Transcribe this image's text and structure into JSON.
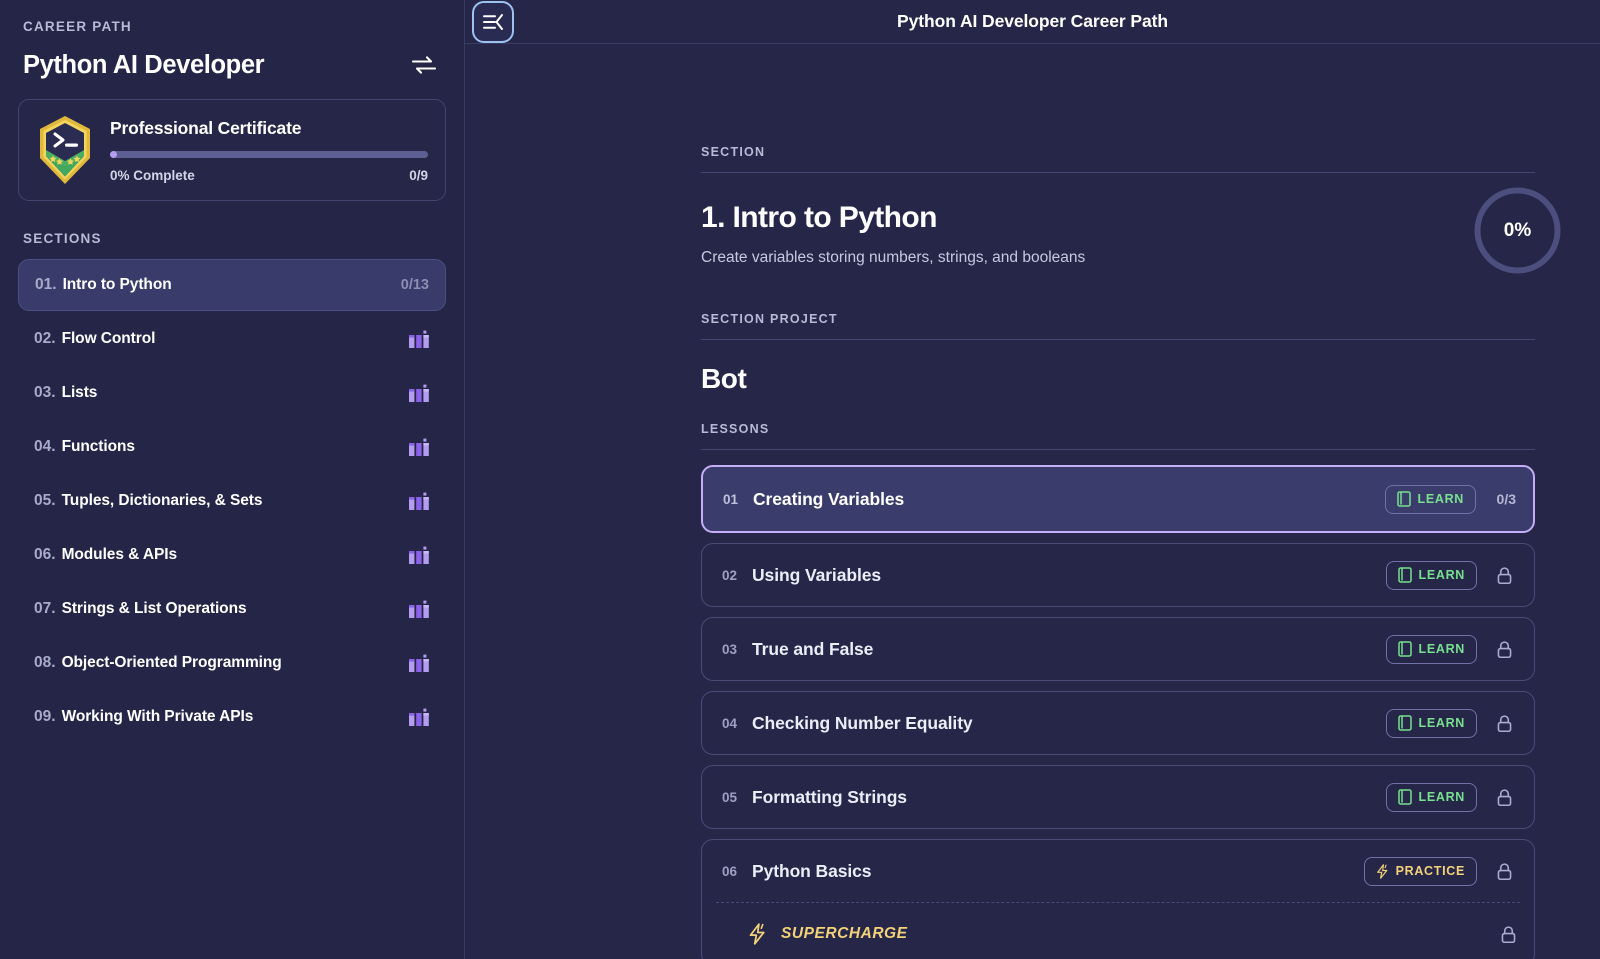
{
  "sidebar": {
    "career_path_eyebrow": "CAREER PATH",
    "path_title": "Python AI Developer",
    "swap_icon": "swap-arrows-icon",
    "certificate": {
      "badge_icon": "certificate-shield-icon",
      "title": "Professional Certificate",
      "progress_label": "0% Complete",
      "progress_count": "0/9",
      "progress_percent": 0
    },
    "sections_eyebrow": "SECTIONS",
    "sections": [
      {
        "num": "01.",
        "label": "Intro to Python",
        "count": "0/13",
        "locked": false,
        "active": true
      },
      {
        "num": "02.",
        "label": "Flow Control",
        "count": "",
        "locked": true,
        "active": false
      },
      {
        "num": "03.",
        "label": "Lists",
        "count": "",
        "locked": true,
        "active": false
      },
      {
        "num": "04.",
        "label": "Functions",
        "count": "",
        "locked": true,
        "active": false
      },
      {
        "num": "05.",
        "label": "Tuples, Dictionaries, & Sets",
        "count": "",
        "locked": true,
        "active": false
      },
      {
        "num": "06.",
        "label": "Modules & APIs",
        "count": "",
        "locked": true,
        "active": false
      },
      {
        "num": "07.",
        "label": "Strings & List Operations",
        "count": "",
        "locked": true,
        "active": false
      },
      {
        "num": "08.",
        "label": "Object-Oriented Programming",
        "count": "",
        "locked": true,
        "active": false
      },
      {
        "num": "09.",
        "label": "Working With Private APIs",
        "count": "",
        "locked": true,
        "active": false
      }
    ]
  },
  "topbar": {
    "collapse_icon": "collapse-sidebar-icon",
    "title": "Python AI Developer Career Path"
  },
  "main": {
    "section_eyebrow": "SECTION",
    "section_title": "1. Intro to Python",
    "section_desc": "Create variables storing numbers, strings, and booleans",
    "progress_percent_label": "0%",
    "progress_percent": 0,
    "project_eyebrow": "SECTION PROJECT",
    "project_title": "Bot",
    "lessons_eyebrow": "LESSONS",
    "lessons": [
      {
        "num": "01",
        "title": "Creating Variables",
        "badge": "LEARN",
        "badge_type": "learn",
        "badge_icon": "book-icon",
        "count": "0/3",
        "locked": false,
        "current": true
      },
      {
        "num": "02",
        "title": "Using Variables",
        "badge": "LEARN",
        "badge_type": "learn",
        "badge_icon": "book-icon",
        "count": "",
        "locked": true,
        "current": false
      },
      {
        "num": "03",
        "title": "True and False",
        "badge": "LEARN",
        "badge_type": "learn",
        "badge_icon": "book-icon",
        "count": "",
        "locked": true,
        "current": false
      },
      {
        "num": "04",
        "title": "Checking Number Equality",
        "badge": "LEARN",
        "badge_type": "learn",
        "badge_icon": "book-icon",
        "count": "",
        "locked": true,
        "current": false
      },
      {
        "num": "05",
        "title": "Formatting Strings",
        "badge": "LEARN",
        "badge_type": "learn",
        "badge_icon": "book-icon",
        "count": "",
        "locked": true,
        "current": false
      },
      {
        "num": "06",
        "title": "Python Basics",
        "badge": "PRACTICE",
        "badge_type": "practice",
        "badge_icon": "lightning-icon",
        "count": "",
        "locked": true,
        "current": false,
        "supercharge": "SUPERCHARGE",
        "supercharge_icon": "lightning-icon"
      }
    ]
  },
  "colors": {
    "page_bg": "#222344",
    "panel_bg": "#252648",
    "sidebar_bg": "#242547",
    "border": "#44466f",
    "active_row": "#393b6b",
    "accent_purple": "#c4aef5",
    "learn_green": "#78e08f",
    "practice_yellow": "#f3d27a",
    "muted_text": "#b9bad6",
    "lock_icon": "#a9abcf",
    "section_lock": "#9b7cf0"
  }
}
